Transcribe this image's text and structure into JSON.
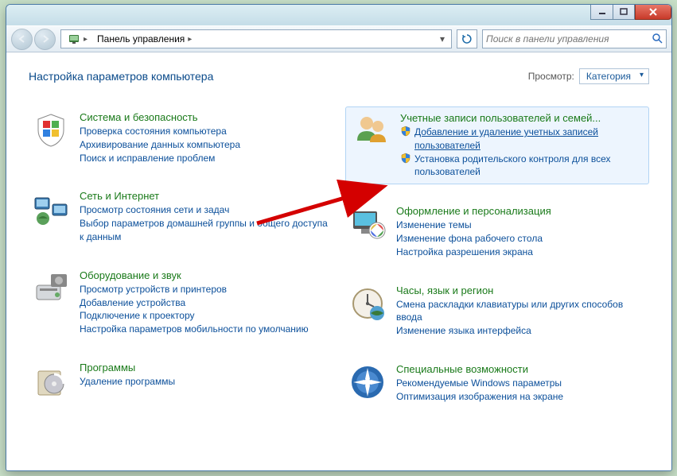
{
  "breadcrumb": {
    "root_label": "Панель управления"
  },
  "search": {
    "placeholder": "Поиск в панели управления"
  },
  "header": {
    "title": "Настройка параметров компьютера",
    "view_label": "Просмотр:",
    "view_value": "Категория"
  },
  "left": [
    {
      "title": "Система и безопасность",
      "links": [
        {
          "text": "Проверка состояния компьютера"
        },
        {
          "text": "Архивирование данных компьютера"
        },
        {
          "text": "Поиск и исправление проблем"
        }
      ]
    },
    {
      "title": "Сеть и Интернет",
      "links": [
        {
          "text": "Просмотр состояния сети и задач"
        },
        {
          "text": "Выбор параметров домашней группы и общего доступа к данным"
        }
      ]
    },
    {
      "title": "Оборудование и звук",
      "links": [
        {
          "text": "Просмотр устройств и принтеров"
        },
        {
          "text": "Добавление устройства"
        },
        {
          "text": "Подключение к проектору"
        },
        {
          "text": "Настройка параметров мобильности по умолчанию"
        }
      ]
    },
    {
      "title": "Программы",
      "links": [
        {
          "text": "Удаление программы"
        }
      ]
    }
  ],
  "right": [
    {
      "title": "Учетные записи пользователей и семей...",
      "highlighted": true,
      "links": [
        {
          "text": "Добавление и удаление учетных записей пользователей",
          "shield": true,
          "underlined": true
        },
        {
          "text": "Установка родительского контроля для всех пользователей",
          "shield": true
        }
      ]
    },
    {
      "title": "Оформление и персонализация",
      "links": [
        {
          "text": "Изменение темы"
        },
        {
          "text": "Изменение фона рабочего стола"
        },
        {
          "text": "Настройка разрешения экрана"
        }
      ]
    },
    {
      "title": "Часы, язык и регион",
      "links": [
        {
          "text": "Смена раскладки клавиатуры или других способов ввода"
        },
        {
          "text": "Изменение языка интерфейса"
        }
      ]
    },
    {
      "title": "Специальные возможности",
      "links": [
        {
          "text": "Рекомендуемые Windows параметры"
        },
        {
          "text": "Оптимизация изображения на экране"
        }
      ]
    }
  ]
}
